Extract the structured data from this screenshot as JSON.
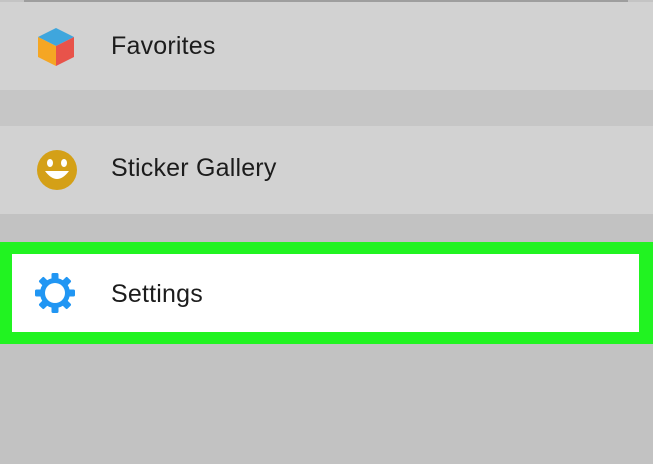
{
  "menu": {
    "items": [
      {
        "label": "Favorites",
        "icon": "cube-icon"
      },
      {
        "label": "Sticker Gallery",
        "icon": "smiley-icon"
      },
      {
        "label": "Settings",
        "icon": "gear-icon",
        "highlighted": true
      }
    ]
  },
  "colors": {
    "highlight": "#21f321",
    "settings_icon": "#2196f3",
    "smiley": "#d4a017",
    "background": "#c4c4c4"
  }
}
